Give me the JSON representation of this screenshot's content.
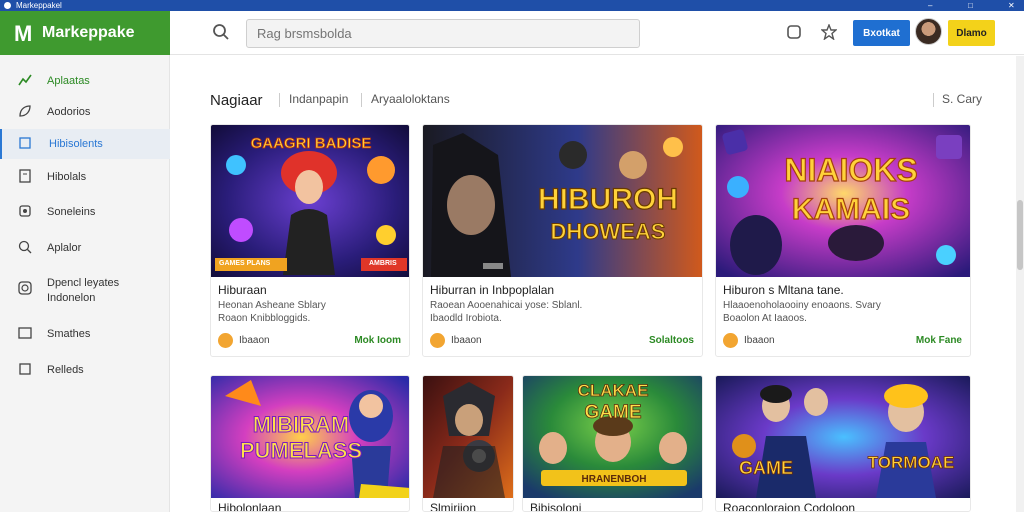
{
  "window": {
    "title": "Markeppakel"
  },
  "brand": {
    "mark": "M",
    "name": "Markeppake",
    "color": "#3f9a2f"
  },
  "topbar": {
    "search_placeholder": "Rag brsmsbolda",
    "button_blue": "Bxotkat",
    "button_yellow": "Dlamo"
  },
  "sidebar": {
    "items": [
      {
        "label": "Aplaatas",
        "icon": "chart-icon"
      },
      {
        "label": "Aodorios",
        "icon": "leaf-icon"
      },
      {
        "label": "Hibisolents",
        "icon": "book-icon"
      },
      {
        "label": "Hibolals",
        "icon": "document-icon"
      },
      {
        "label": "Soneleins",
        "icon": "gear-icon"
      },
      {
        "label": "Aplalor",
        "icon": "search-icon"
      },
      {
        "label": "Dpencl leyates",
        "label2": "Indonelon",
        "icon": "refresh-icon"
      },
      {
        "label": "Smathes",
        "icon": "window-icon"
      },
      {
        "label": "Relleds",
        "icon": "square-icon"
      }
    ]
  },
  "filters": {
    "heading": "Nagiaar",
    "f1": "Indanpapin",
    "f2": "Aryaaloloktans",
    "sort": "S. Cary"
  },
  "cards": [
    {
      "title": "Hiburaan",
      "desc1": "Heonan Asheane Sblary",
      "desc2": "Roaon Knibbloggids.",
      "price": "Ibaaon",
      "link": "Mok Ioom",
      "banner_left": "GAMES PLANS",
      "banner_right": "AMBRIS",
      "art_title": "GAAGRI BADISE"
    },
    {
      "title": "Hiburran in Inbpoplalan",
      "desc1": "Raoean Aooenahicai yose: Sblanl.",
      "desc2": "Ibaodld Irobiota.",
      "price": "Ibaaon",
      "link": "Solaltoos",
      "art_title": "HIBUROH",
      "art_sub": "DHOWEAS"
    },
    {
      "title": "Hiburon s Mltana tane.",
      "desc1": "Hlaaoenoholaooiny enoaons. Svary",
      "desc2": "Boaolon At Iaaoos.",
      "price": "Ibaaon",
      "link": "Mok Fane",
      "art_title": "NIAIOKS",
      "art_sub": "KAMAIS"
    },
    {
      "title": "Hibolonlaan",
      "art_title": "MIBIRAM",
      "art_sub": "PUMELASS"
    },
    {
      "title": "Slmiriion Coduo"
    },
    {
      "title": "Bibisoloni",
      "art_title": "CLAKAE",
      "art_sub": "GAME",
      "banner": "HRANENBOH"
    },
    {
      "title": "Roaconloraion Codoloon",
      "art_title": "GAME",
      "art_sub": "TORMOAE"
    }
  ]
}
